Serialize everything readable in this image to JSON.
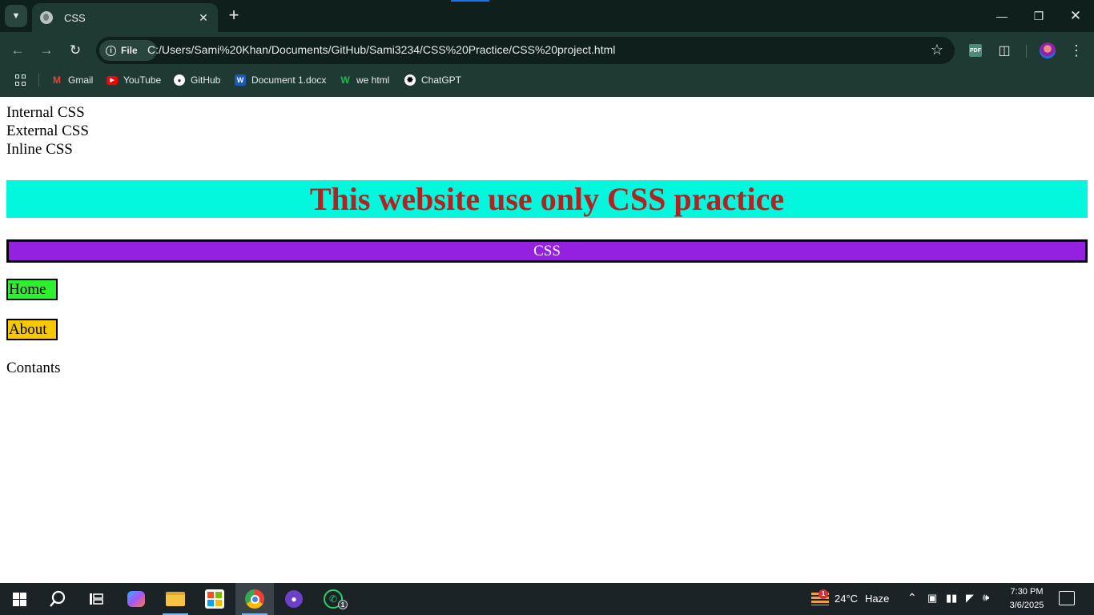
{
  "browser": {
    "tab_title": "CSS",
    "url_chip": "File",
    "url": "C:/Users/Sami%20Khan/Documents/GitHub/Sami3234/CSS%20Practice/CSS%20project.html",
    "bookmarks": [
      {
        "label": "Gmail",
        "icon": "gmail-icon"
      },
      {
        "label": "YouTube",
        "icon": "youtube-icon"
      },
      {
        "label": "GitHub",
        "icon": "github-icon"
      },
      {
        "label": "Document 1.docx",
        "icon": "word-icon"
      },
      {
        "label": "we html",
        "icon": "w-icon"
      },
      {
        "label": "ChatGPT",
        "icon": "chatgpt-icon"
      }
    ]
  },
  "page": {
    "lines": [
      "Internal CSS",
      "External CSS",
      "Inline CSS"
    ],
    "banner": "This website use only CSS practice",
    "css_bar": "CSS",
    "home": "Home",
    "about": "About",
    "contents": "Contants",
    "colors": {
      "banner_bg": "#02f7dc",
      "banner_text": "#b22222",
      "css_bar_bg": "#9420e0",
      "home_bg": "#2ff02f",
      "about_bg": "#f7c800"
    }
  },
  "taskbar": {
    "weather_temp": "24°C",
    "weather_desc": "Haze",
    "weather_badge": "1",
    "whatsapp_badge": "1",
    "time": "7:30 PM",
    "date": "3/6/2025"
  }
}
